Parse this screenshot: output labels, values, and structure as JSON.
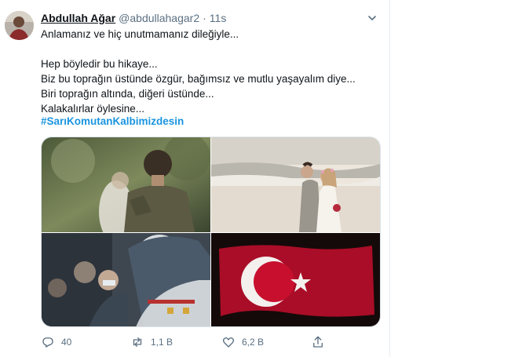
{
  "tweet": {
    "author": {
      "display_name": "Abdullah Ağar",
      "handle": "@abdullahagar2",
      "separator": "·",
      "time": "11s"
    },
    "lines": [
      "Anlamanız ve hiç unutmamanız dileğiyle...",
      "",
      "Hep böyledir bu hikaye...",
      "Biz bu toprağın üstünde özgür, bağımsız ve mutlu yaşayalım diye...",
      "Biri toprağın altında, diğeri üstünde...",
      "Kalakalırlar öylesine..."
    ],
    "hashtag": "#SarıKomutanKalbimizdesin",
    "media": [
      {
        "icon": "soldier-back-photo"
      },
      {
        "icon": "beach-couple-photo"
      },
      {
        "icon": "funeral-crowd-photo"
      },
      {
        "icon": "turkish-flag-photo"
      }
    ],
    "actions": {
      "reply": {
        "icon": "reply-icon",
        "count": "40"
      },
      "retweet": {
        "icon": "retweet-icon",
        "count": "1,1 B"
      },
      "like": {
        "icon": "heart-icon",
        "count": "6,2 B"
      },
      "share": {
        "icon": "share-icon"
      }
    }
  },
  "colors": {
    "accent": "#1b95e0",
    "muted": "#5b7083",
    "flag_red": "#c8102e"
  }
}
